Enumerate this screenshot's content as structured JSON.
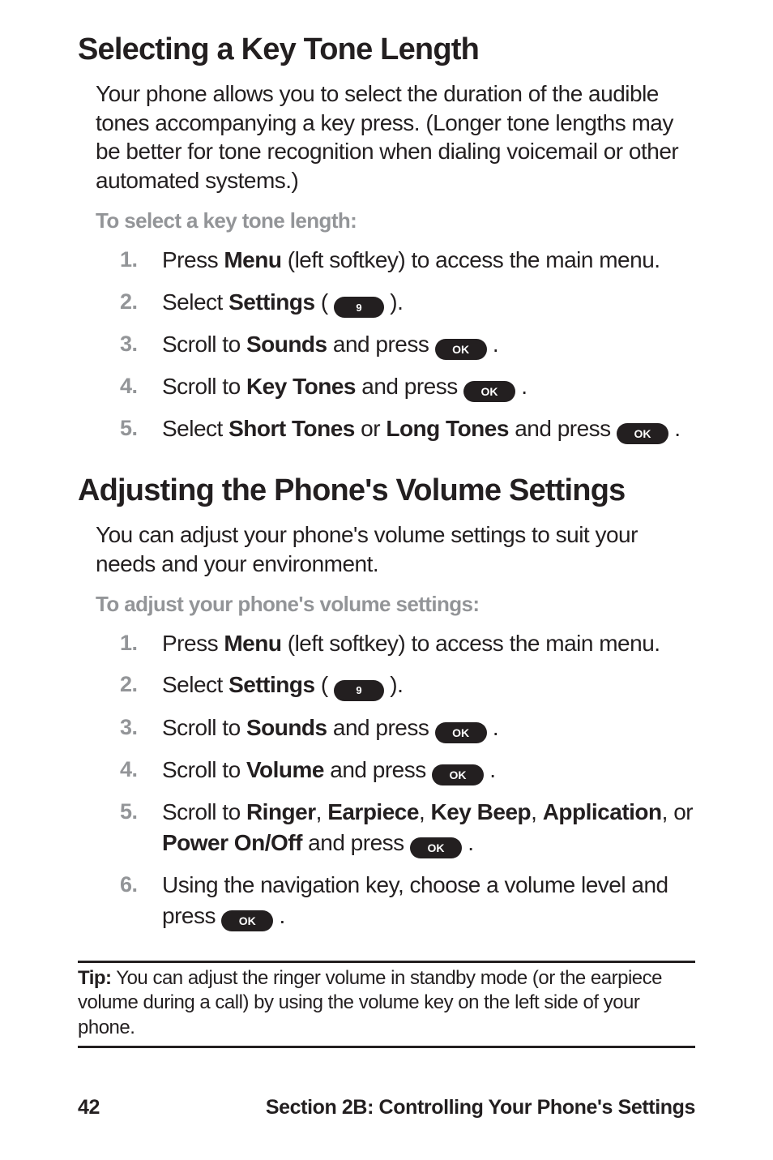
{
  "icons": {
    "ok": "OK",
    "nine": "9"
  },
  "sectionA": {
    "title": "Selecting a Key Tone Length",
    "intro": "Your phone allows you to select the duration of the audible tones accompanying a key press. (Longer tone lengths may be better for tone recognition when dialing voicemail or other automated systems.)",
    "subheading": "To select a key tone length:",
    "steps": {
      "s1": {
        "pre": "Press ",
        "b1": "Menu",
        "post": " (left softkey) to access the main menu."
      },
      "s2": {
        "pre": "Select ",
        "b1": "Settings",
        "mid": " ( ",
        "post": " )."
      },
      "s3": {
        "pre": "Scroll to ",
        "b1": "Sounds",
        "mid": " and press ",
        "post": " ."
      },
      "s4": {
        "pre": "Scroll to ",
        "b1": "Key Tones",
        "mid": " and press ",
        "post": " ."
      },
      "s5": {
        "pre": "Select ",
        "b1": "Short Tones",
        "mid": " or ",
        "b2": "Long Tones",
        "mid2": " and press ",
        "post": " ."
      }
    }
  },
  "sectionB": {
    "title": "Adjusting the Phone's Volume Settings",
    "intro": "You can adjust your phone's volume settings to suit your needs and your environment.",
    "subheading": "To adjust your phone's volume settings:",
    "steps": {
      "s1": {
        "pre": "Press ",
        "b1": "Menu",
        "post": " (left softkey) to access the main menu."
      },
      "s2": {
        "pre": "Select ",
        "b1": "Settings",
        "mid": " ( ",
        "post": " )."
      },
      "s3": {
        "pre": "Scroll to ",
        "b1": "Sounds",
        "mid": " and press ",
        "post": " ."
      },
      "s4": {
        "pre": "Scroll to ",
        "b1": "Volume",
        "mid": " and press ",
        "post": " ."
      },
      "s5": {
        "pre": "Scroll to ",
        "b1": "Ringer",
        "c1": ", ",
        "b2": "Earpiece",
        "c2": ", ",
        "b3": "Key Beep",
        "c3": ", ",
        "b4": "Application",
        "c4": ", or ",
        "b5": "Power On/Off",
        "mid": " and press ",
        "post": " ."
      },
      "s6": {
        "pre": "Using the navigation key, choose a volume level and press ",
        "post": " ."
      }
    }
  },
  "tip": {
    "label": "Tip:",
    "text": " You can adjust the ringer volume in standby mode (or the earpiece volume during a call) by using the volume key on the left side of your phone."
  },
  "footer": {
    "page": "42",
    "section": "Section 2B: Controlling Your Phone's Settings"
  }
}
